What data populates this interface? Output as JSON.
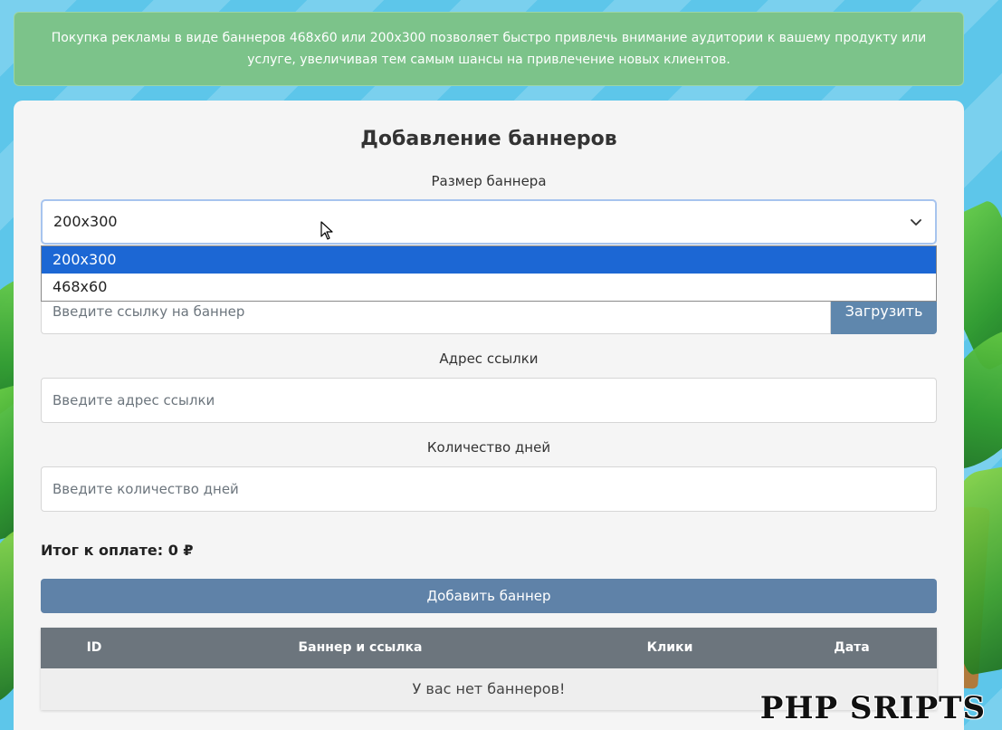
{
  "alert": {
    "text": "Покупка рекламы в виде баннеров 468x60 или 200x300 позволяет быстро привлечь внимание аудитории к вашему продукту или услуге, увеличивая тем самым шансы на привлечение новых клиентов."
  },
  "form": {
    "title": "Добавление баннеров",
    "size_label": "Размер баннера",
    "size_selected": "200x300",
    "size_options": [
      "200x300",
      "468x60"
    ],
    "banner_link_placeholder": "Введите ссылку на баннер",
    "upload_label": "Загрузить",
    "url_label": "Адрес ссылки",
    "url_placeholder": "Введите адрес ссылки",
    "days_label": "Количество дней",
    "days_placeholder": "Введите количество дней",
    "total_label": "Итог к оплате:",
    "total_value": "0 ₽",
    "add_button": "Добавить баннер"
  },
  "table": {
    "headers": [
      "ID",
      "Баннер и ссылка",
      "Клики",
      "Дата"
    ],
    "empty_message": "У вас нет баннеров!"
  },
  "watermark": "PHP SRIPTS",
  "colors": {
    "background": "#5dc6ea",
    "alert": "#7cc38a",
    "button": "#5f82a8",
    "table_header": "#6c757d",
    "selected_option": "#1c67d4"
  }
}
